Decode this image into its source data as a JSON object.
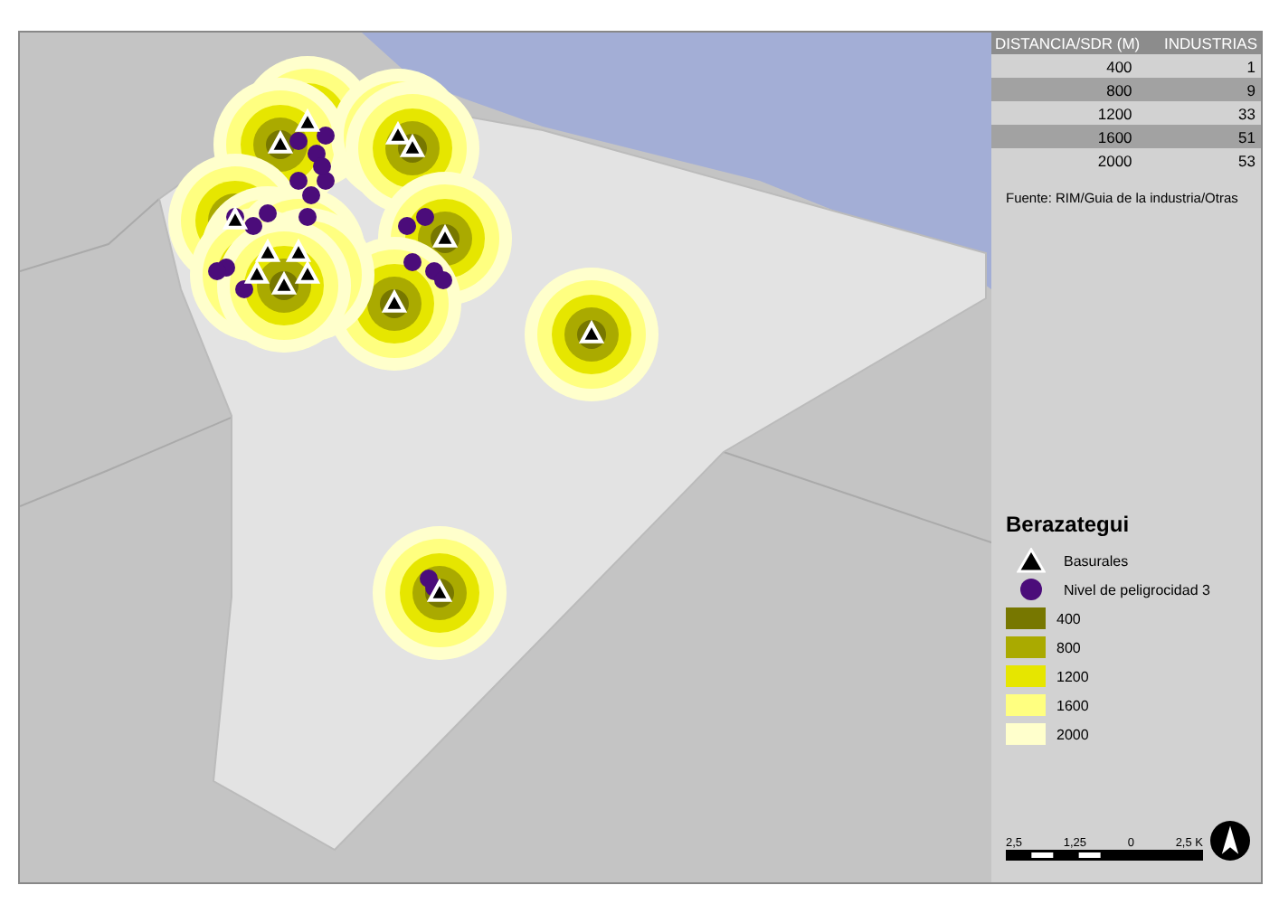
{
  "table": {
    "columns": [
      "DISTANCIA/SDR (M)",
      "INDUSTRIAS"
    ],
    "rows": [
      [
        "400",
        "1"
      ],
      [
        "800",
        "9"
      ],
      [
        "1200",
        "33"
      ],
      [
        "1600",
        "51"
      ],
      [
        "2000",
        "53"
      ]
    ]
  },
  "source": "Fuente: RIM/Guia de la industria/Otras",
  "legend": {
    "title": "Berazategui",
    "items": [
      {
        "kind": "triangle",
        "label": "Basurales"
      },
      {
        "kind": "dot",
        "label": "Nivel de peligrocidad 3",
        "color": "#4b0c7a"
      },
      {
        "kind": "swatch",
        "label": "400",
        "color": "#777700"
      },
      {
        "kind": "swatch",
        "label": "800",
        "color": "#aaaa00"
      },
      {
        "kind": "swatch",
        "label": "1200",
        "color": "#e6e600"
      },
      {
        "kind": "swatch",
        "label": "1600",
        "color": "#ffff80"
      },
      {
        "kind": "swatch",
        "label": "2000",
        "color": "#ffffcc"
      }
    ]
  },
  "scale_bar": {
    "labels": [
      "2,5",
      "1,25",
      "0",
      "2,5 K"
    ]
  }
}
